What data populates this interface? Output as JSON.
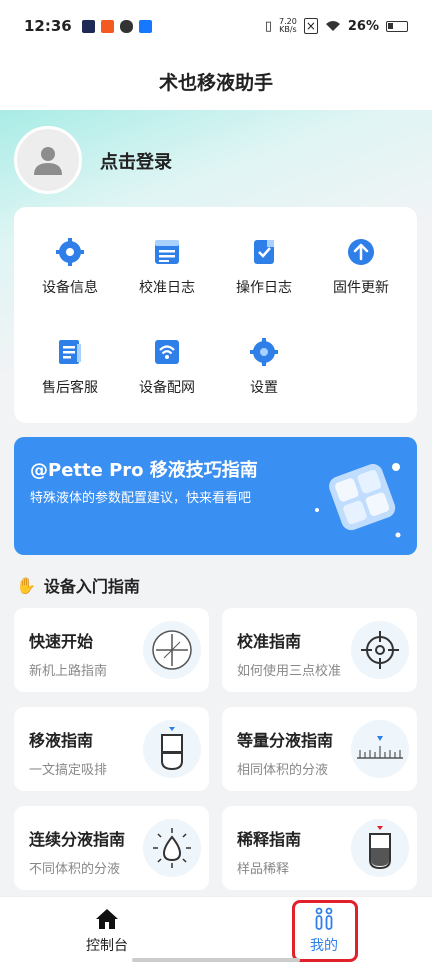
{
  "status_bar": {
    "time": "12:36",
    "net_speed_value": "7.20",
    "net_speed_unit": "KB/s",
    "battery": "26%"
  },
  "header": {
    "title": "术也移液助手"
  },
  "profile": {
    "login_label": "点击登录"
  },
  "menu": {
    "items": [
      {
        "label": "设备信息",
        "icon": "gear-icon"
      },
      {
        "label": "校准日志",
        "icon": "document-icon"
      },
      {
        "label": "操作日志",
        "icon": "checklist-icon"
      },
      {
        "label": "固件更新",
        "icon": "upload-icon"
      },
      {
        "label": "售后客服",
        "icon": "service-icon"
      },
      {
        "label": "设备配网",
        "icon": "wifi-icon"
      },
      {
        "label": "设置",
        "icon": "settings-icon"
      }
    ]
  },
  "banner": {
    "title": "@Pette Pro 移液技巧指南",
    "subtitle": "特殊液体的参数配置建议，快来看看吧"
  },
  "guide": {
    "section_title": "设备入门指南",
    "cards": [
      {
        "title": "快速开始",
        "subtitle": "新机上路指南",
        "icon": "compass-icon"
      },
      {
        "title": "校准指南",
        "subtitle": "如何使用三点校准",
        "icon": "crosshair-icon"
      },
      {
        "title": "移液指南",
        "subtitle": "一文搞定吸排",
        "icon": "tube-icon"
      },
      {
        "title": "等量分液指南",
        "subtitle": "相同体积的分液",
        "icon": "ruler-icon"
      },
      {
        "title": "连续分液指南",
        "subtitle": "不同体积的分液",
        "icon": "droplet-icon"
      },
      {
        "title": "稀释指南",
        "subtitle": "样品稀释",
        "icon": "dilution-tube-icon"
      }
    ]
  },
  "tabs": [
    {
      "label": "控制台",
      "icon": "home-icon"
    },
    {
      "label": "我的",
      "icon": "person-icon",
      "active": true
    }
  ],
  "colors": {
    "accent": "#3a8ff2",
    "highlight": "#e0202a"
  }
}
